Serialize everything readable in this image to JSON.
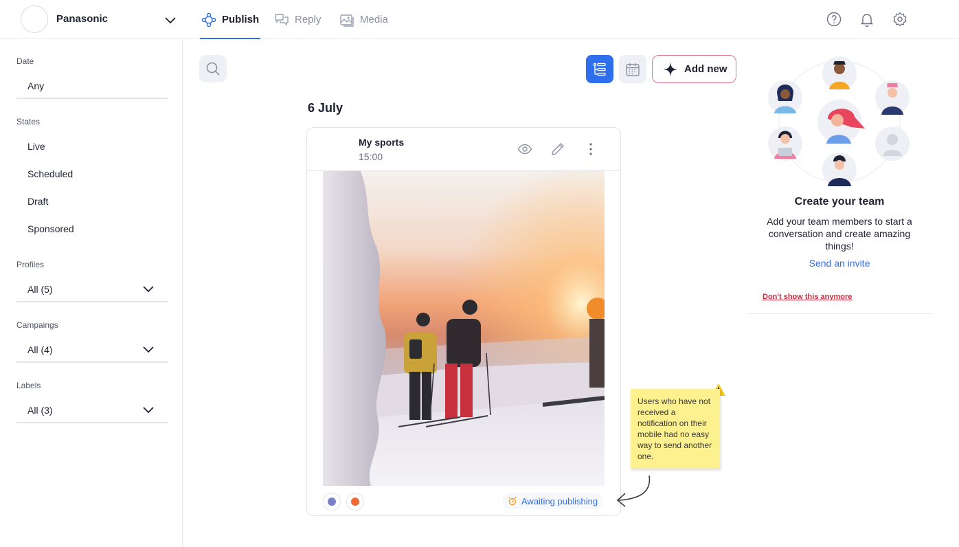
{
  "header": {
    "account_name": "Panasonic",
    "tabs": [
      {
        "label": "Publish",
        "active": true,
        "icon": "publish-icon"
      },
      {
        "label": "Reply",
        "active": false,
        "icon": "reply-icon"
      },
      {
        "label": "Media",
        "active": false,
        "icon": "media-icon"
      }
    ],
    "right_icons": [
      "help-icon",
      "bell-icon",
      "settings-icon"
    ]
  },
  "sidebar": {
    "date": {
      "label": "Date",
      "value": "Any"
    },
    "states": {
      "label": "States",
      "items": [
        "Live",
        "Scheduled",
        "Draft",
        "Sponsored"
      ]
    },
    "profiles": {
      "label": "Profiles",
      "value": "All (5)"
    },
    "campaigns": {
      "label": "Campaings",
      "value": "All (4)"
    },
    "labels": {
      "label": "Labels",
      "value": "All (3)"
    }
  },
  "toolbar": {
    "add_new_label": "Add new"
  },
  "feed": {
    "date_heading": "6 July",
    "post": {
      "title": "My sports",
      "time": "15:00",
      "status": "Awaiting publishing",
      "dots": [
        "#7b80c9",
        "#f06a35"
      ]
    }
  },
  "sticky_note": {
    "text": "Users who have not received a notification on their mobile had no easy way to send another one."
  },
  "team_panel": {
    "title": "Create your team",
    "description": "Add your team members to start a conversation and create amazing things!",
    "invite_label": "Send an invite",
    "dismiss_label": "Don't show this anymore"
  },
  "colors": {
    "accent": "#2f6fed",
    "danger": "#d0283b",
    "note": "#fdf08e"
  }
}
